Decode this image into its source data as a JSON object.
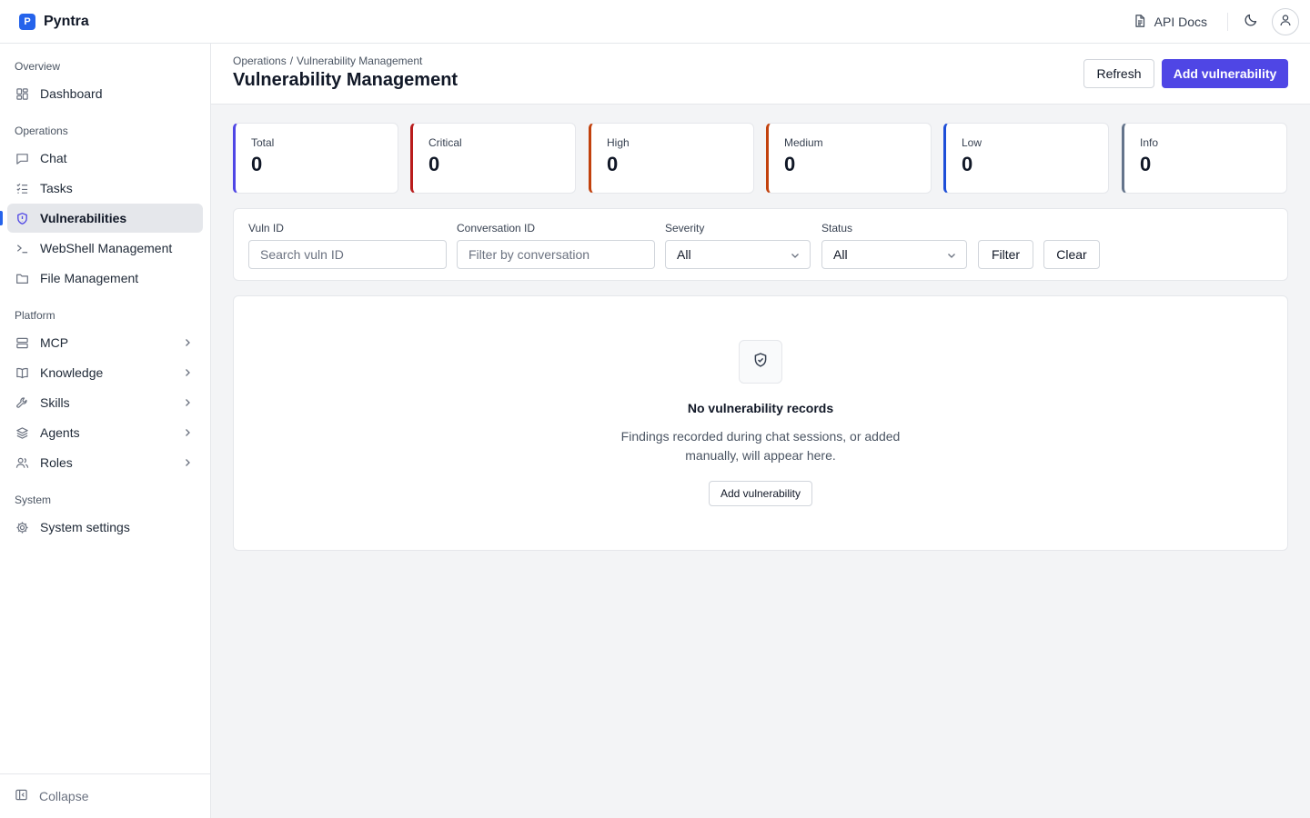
{
  "app": {
    "name": "Pyntra",
    "logo_letter": "P"
  },
  "topbar": {
    "api_docs": "API Docs"
  },
  "sidebar": {
    "sections": [
      {
        "title": "Overview",
        "items": [
          {
            "label": "Dashboard",
            "icon": "dashboard-icon"
          }
        ]
      },
      {
        "title": "Operations",
        "items": [
          {
            "label": "Chat",
            "icon": "chat-icon"
          },
          {
            "label": "Tasks",
            "icon": "tasks-icon"
          },
          {
            "label": "Vulnerabilities",
            "icon": "shield-icon",
            "active": true
          },
          {
            "label": "WebShell Management",
            "icon": "terminal-icon"
          },
          {
            "label": "File Management",
            "icon": "folder-icon"
          }
        ]
      },
      {
        "title": "Platform",
        "items": [
          {
            "label": "MCP",
            "icon": "server-icon",
            "expandable": true
          },
          {
            "label": "Knowledge",
            "icon": "book-icon",
            "expandable": true
          },
          {
            "label": "Skills",
            "icon": "wrench-icon",
            "expandable": true
          },
          {
            "label": "Agents",
            "icon": "layers-icon",
            "expandable": true
          },
          {
            "label": "Roles",
            "icon": "users-icon",
            "expandable": true
          }
        ]
      },
      {
        "title": "System",
        "items": [
          {
            "label": "System settings",
            "icon": "gear-icon"
          }
        ]
      }
    ],
    "collapse_label": "Collapse"
  },
  "header": {
    "breadcrumb": [
      "Operations",
      "Vulnerability Management"
    ],
    "breadcrumb_sep": "/",
    "title": "Vulnerability Management",
    "refresh_label": "Refresh",
    "add_label": "Add vulnerability"
  },
  "stats": [
    {
      "label": "Total",
      "value": "0",
      "color": "#4f46e5"
    },
    {
      "label": "Critical",
      "value": "0",
      "color": "#b91c1c"
    },
    {
      "label": "High",
      "value": "0",
      "color": "#c2410c"
    },
    {
      "label": "Medium",
      "value": "0",
      "color": "#c2410c"
    },
    {
      "label": "Low",
      "value": "0",
      "color": "#1d4ed8"
    },
    {
      "label": "Info",
      "value": "0",
      "color": "#64748b"
    }
  ],
  "filters": {
    "vuln_id": {
      "label": "Vuln ID",
      "placeholder": "Search vuln ID"
    },
    "conversation_id": {
      "label": "Conversation ID",
      "placeholder": "Filter by conversation"
    },
    "severity": {
      "label": "Severity",
      "value": "All"
    },
    "status": {
      "label": "Status",
      "value": "All"
    },
    "filter_label": "Filter",
    "clear_label": "Clear"
  },
  "empty_state": {
    "icon": "shield-check-icon",
    "title": "No vulnerability records",
    "description": "Findings recorded during chat sessions, or added manually, will appear here.",
    "button_label": "Add vulnerability"
  }
}
